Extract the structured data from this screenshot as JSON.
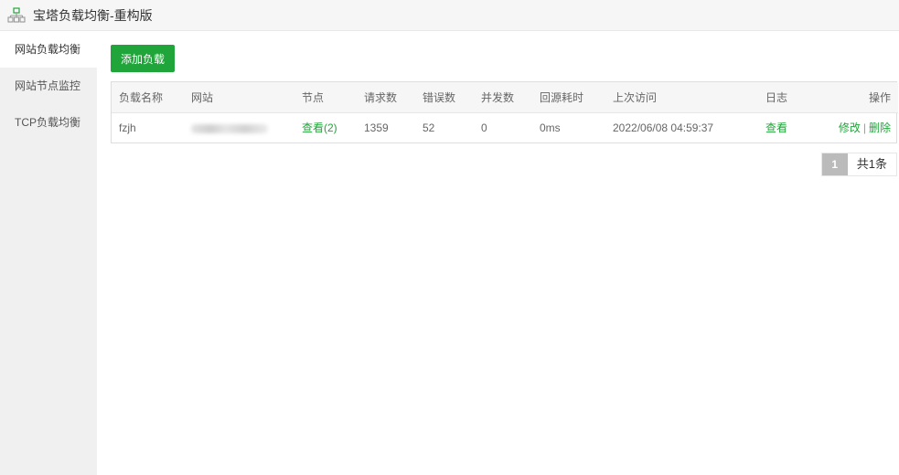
{
  "titlebar": {
    "title": "宝塔负载均衡-重构版",
    "icon": "sitemap-icon"
  },
  "sidebar": {
    "items": [
      {
        "label": "网站负载均衡",
        "active": true
      },
      {
        "label": "网站节点监控",
        "active": false
      },
      {
        "label": "TCP负载均衡",
        "active": false
      }
    ]
  },
  "toolbar": {
    "add_label": "添加负载"
  },
  "table": {
    "headers": {
      "name": "负载名称",
      "site": "网站",
      "nodes": "节点",
      "requests": "请求数",
      "errors": "错误数",
      "concurrency": "并发数",
      "latency": "回源耗时",
      "last_visit": "上次访问",
      "log": "日志",
      "actions": "操作"
    },
    "rows": [
      {
        "name": "fzjh",
        "nodes": "查看(2)",
        "requests": "1359",
        "errors": "52",
        "concurrency": "0",
        "latency": "0ms",
        "last_visit": "2022/06/08 04:59:37",
        "log": "查看",
        "edit": "修改",
        "separator": "|",
        "delete": "删除"
      }
    ]
  },
  "pager": {
    "current": "1",
    "total": "共1条"
  },
  "colors": {
    "accent": "#20a53a",
    "sidebar_bg": "#f0f0f0",
    "header_bg": "#f6f6f6"
  }
}
